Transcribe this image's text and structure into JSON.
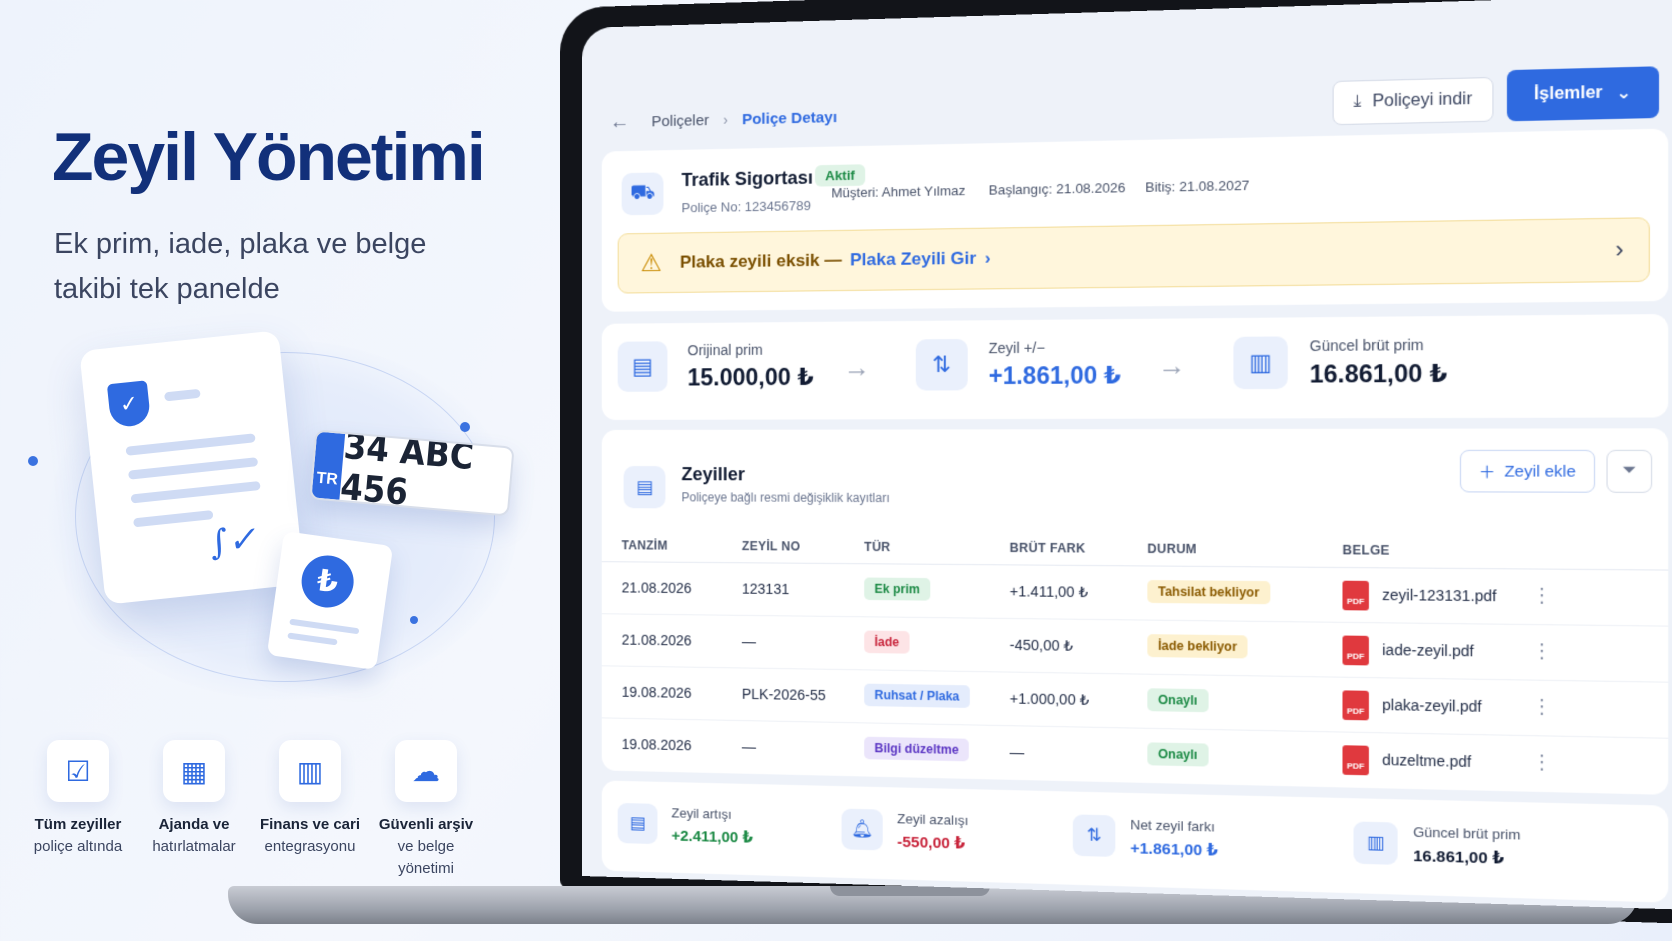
{
  "promo": {
    "title": "Zeyil Yönetimi",
    "subtitle": "Ek prim, iade, plaka ve belge takibi tek panelde",
    "plate": {
      "country": "TR",
      "number": "34 ABC 456"
    },
    "currency_symbol": "₺",
    "features": [
      {
        "icon": "checklist-icon",
        "line1": "Tüm zeyiller",
        "line2": "poliçe altında"
      },
      {
        "icon": "calendar-bell-icon",
        "line1": "Ajanda ve",
        "line2": "hatırlatmalar"
      },
      {
        "icon": "bar-chart-icon",
        "line1": "Finans ve cari",
        "line2": "entegrasyonu"
      },
      {
        "icon": "cloud-lock-icon",
        "line1": "Güvenli arşiv",
        "line2": "ve belge yönetimi"
      }
    ]
  },
  "app": {
    "breadcrumb": {
      "parent": "Poliçeler",
      "current": "Poliçe Detayı"
    },
    "download_button": "Poliçeyi indir",
    "actions_button": "İşlemler",
    "policy": {
      "name": "Trafik Sigortası",
      "status": "Aktif",
      "number": "Poliçe No: 123456789",
      "customer": "Müşteri: Ahmet Yılmaz",
      "start": "Başlangıç: 21.08.2026",
      "end": "Bitiş: 21.08.2027"
    },
    "alert": {
      "text": "Plaka zeyili eksik —",
      "link": "Plaka Zeyili Gir"
    },
    "premiums": {
      "original": {
        "label": "Orijinal prim",
        "value": "15.000,00 ₺"
      },
      "change": {
        "label": "Zeyil +/−",
        "value": "+1.861,00 ₺"
      },
      "current": {
        "label": "Güncel brüt prim",
        "value": "16.861,00 ₺"
      }
    },
    "zeyiller": {
      "title": "Zeyiller",
      "subtitle": "Poliçeye bağlı resmi değişiklik kayıtları",
      "add_button": "Zeyil ekle",
      "columns": [
        "TANZİM",
        "ZEYİL NO",
        "TÜR",
        "BRÜT FARK",
        "DURUM",
        "BELGE"
      ],
      "rows": [
        {
          "date": "21.08.2026",
          "no": "123131",
          "type": "Ek prim",
          "type_style": "green",
          "diff": "+1.411,00 ₺",
          "status": "Tahsilat bekliyor",
          "status_style": "yellow",
          "file": "zeyil-123131.pdf"
        },
        {
          "date": "21.08.2026",
          "no": "—",
          "type": "İade",
          "type_style": "red",
          "diff": "-450,00 ₺",
          "status": "İade bekliyor",
          "status_style": "yellow",
          "file": "iade-zeyil.pdf"
        },
        {
          "date": "19.08.2026",
          "no": "PLK-2026-55",
          "type": "Ruhsat / Plaka",
          "type_style": "blue",
          "diff": "+1.000,00 ₺",
          "status": "Onaylı",
          "status_style": "green",
          "file": "plaka-zeyil.pdf"
        },
        {
          "date": "19.08.2026",
          "no": "—",
          "type": "Bilgi düzeltme",
          "type_style": "purple",
          "diff": "—",
          "status": "Onaylı",
          "status_style": "green",
          "file": "duzeltme.pdf"
        }
      ]
    },
    "summary": {
      "increase": {
        "label": "Zeyil artışı",
        "value": "+2.411,00 ₺"
      },
      "decrease": {
        "label": "Zeyil azalışı",
        "value": "-550,00 ₺"
      },
      "net": {
        "label": "Net zeyil farkı",
        "value": "+1.861,00 ₺"
      },
      "current": {
        "label": "Güncel brüt prim",
        "value": "16.861,00 ₺"
      }
    }
  }
}
